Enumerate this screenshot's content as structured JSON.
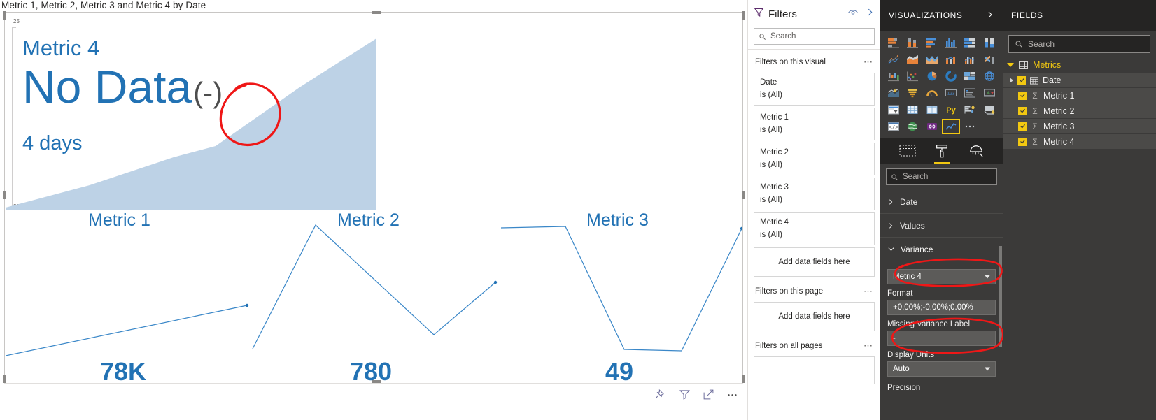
{
  "visual": {
    "title": "Metric 1, Metric 2, Metric 3 and Metric 4 by Date",
    "axis_top": "25",
    "axis_bottom": "22",
    "metric4_card": {
      "label": "Metric 4",
      "value": "No Data",
      "variance": "(-)",
      "subtitle": "4 days"
    },
    "panels": [
      {
        "title": "Metric 1",
        "value": "78K"
      },
      {
        "title": "Metric 2",
        "value": "780"
      },
      {
        "title": "Metric 3",
        "value": "49"
      }
    ],
    "toolbar": {
      "pin_icon": "pin-icon",
      "filter_icon": "filter-icon",
      "focus_icon": "focus-mode-icon",
      "more_icon": "more-options-icon"
    }
  },
  "chart_data": {
    "type": "line",
    "title": "Metric 1, Metric 2, Metric 3 and Metric 4 by Date",
    "xlabel": "Date",
    "ylabel": "",
    "grid": false,
    "legend": "none",
    "axis_ticks": [
      "25",
      "22"
    ],
    "panels": [
      {
        "name": "Metric 4",
        "display": "No Data",
        "variance_label": "(-)",
        "period": "4 days",
        "render": "area",
        "x": [
          0,
          1,
          2,
          3,
          4,
          5
        ],
        "values": [
          22.0,
          22.4,
          22.8,
          23.2,
          24.2,
          25.0
        ]
      },
      {
        "name": "Metric 1",
        "display": "78K",
        "render": "line",
        "x": [
          0,
          1,
          2,
          3,
          4,
          5
        ],
        "values": [
          10,
          20,
          30,
          40,
          50,
          62
        ]
      },
      {
        "name": "Metric 2",
        "display": "780",
        "render": "line",
        "x": [
          0,
          1,
          2,
          3,
          4,
          5
        ],
        "values": [
          4,
          52,
          88,
          60,
          24,
          56
        ]
      },
      {
        "name": "Metric 3",
        "display": "49",
        "render": "line",
        "x": [
          0,
          1,
          2,
          3,
          4,
          5
        ],
        "values": [
          84,
          84,
          84,
          12,
          12,
          94
        ]
      }
    ]
  },
  "filters": {
    "title": "Filters",
    "search_placeholder": "Search",
    "eye_icon": "hide-pane-icon",
    "expand_icon": "expand-pane-icon",
    "sections": [
      {
        "heading": "Filters on this visual",
        "cards": [
          {
            "name": "Date",
            "value": "is (All)"
          },
          {
            "name": "Metric 1",
            "value": "is (All)"
          },
          {
            "name": "Metric 2",
            "value": "is (All)"
          },
          {
            "name": "Metric 3",
            "value": "is (All)"
          },
          {
            "name": "Metric 4",
            "value": "is (All)"
          }
        ],
        "dropzone": "Add data fields here"
      },
      {
        "heading": "Filters on this page",
        "cards": [],
        "dropzone": "Add data fields here"
      },
      {
        "heading": "Filters on all pages",
        "cards": [],
        "dropzone": ""
      }
    ]
  },
  "visualizations": {
    "title": "VISUALIZATIONS",
    "expand_icon": "chevron-right-icon",
    "icons": [
      "stacked-bar-chart-icon",
      "stacked-column-chart-icon",
      "clustered-bar-chart-icon",
      "clustered-column-chart-icon",
      "hundred-percent-stacked-bar-icon",
      "hundred-percent-stacked-column-icon",
      "line-chart-icon",
      "area-chart-icon",
      "stacked-area-chart-icon",
      "line-and-stacked-column-icon",
      "line-and-clustered-column-icon",
      "ribbon-chart-icon",
      "waterfall-chart-icon",
      "scatter-chart-icon",
      "pie-chart-icon",
      "donut-chart-icon",
      "treemap-icon",
      "map-icon",
      "filled-map-icon",
      "funnel-icon",
      "gauge-icon",
      "card-icon",
      "multi-row-card-icon",
      "kpi-icon",
      "slicer-icon",
      "table-icon",
      "matrix-icon",
      "python-visual-icon",
      "key-influencers-icon",
      "decomposition-tree-icon",
      "r-script-visual-icon",
      "arcgis-maps-icon",
      "smart-narrative-icon",
      "variance-chart-icon",
      "more-visuals-icon"
    ],
    "selected_icon": "variance-chart-icon",
    "tabs": [
      {
        "name": "fields-tab",
        "icon": "fields-pane-icon",
        "active": false
      },
      {
        "name": "format-tab",
        "icon": "paint-roller-icon",
        "active": true
      },
      {
        "name": "analytics-tab",
        "icon": "magnifier-analytics-icon",
        "active": false
      }
    ],
    "format": {
      "search_placeholder": "Search",
      "sections": [
        {
          "label": "Date",
          "expanded": false
        },
        {
          "label": "Values",
          "expanded": false
        },
        {
          "label": "Variance",
          "expanded": true
        }
      ],
      "variance": {
        "measure": "Metric 4",
        "format_label": "Format",
        "format_value": "+0.00%;-0.00%;0.00%",
        "missing_label": "Missing Variance Label",
        "missing_value": "-",
        "display_units_label": "Display Units",
        "display_units_value": "Auto",
        "precision_label": "Precision"
      }
    }
  },
  "fields": {
    "title": "FIELDS",
    "search_placeholder": "Search",
    "table": "Metrics",
    "items": [
      {
        "label": "Date",
        "kind": "date",
        "checked": true,
        "expandable": true
      },
      {
        "label": "Metric 1",
        "kind": "measure",
        "checked": true,
        "expandable": false
      },
      {
        "label": "Metric 2",
        "kind": "measure",
        "checked": true,
        "expandable": false
      },
      {
        "label": "Metric 3",
        "kind": "measure",
        "checked": true,
        "expandable": false
      },
      {
        "label": "Metric 4",
        "kind": "measure",
        "checked": true,
        "expandable": false
      }
    ]
  },
  "colors": {
    "accent_blue": "#2272b4",
    "area_fill": "#bdd2e6",
    "annotation_red": "#ef1717",
    "brand_yellow": "#f2c811",
    "pane_dark": "#3b3a39",
    "pane_darker": "#252423"
  }
}
